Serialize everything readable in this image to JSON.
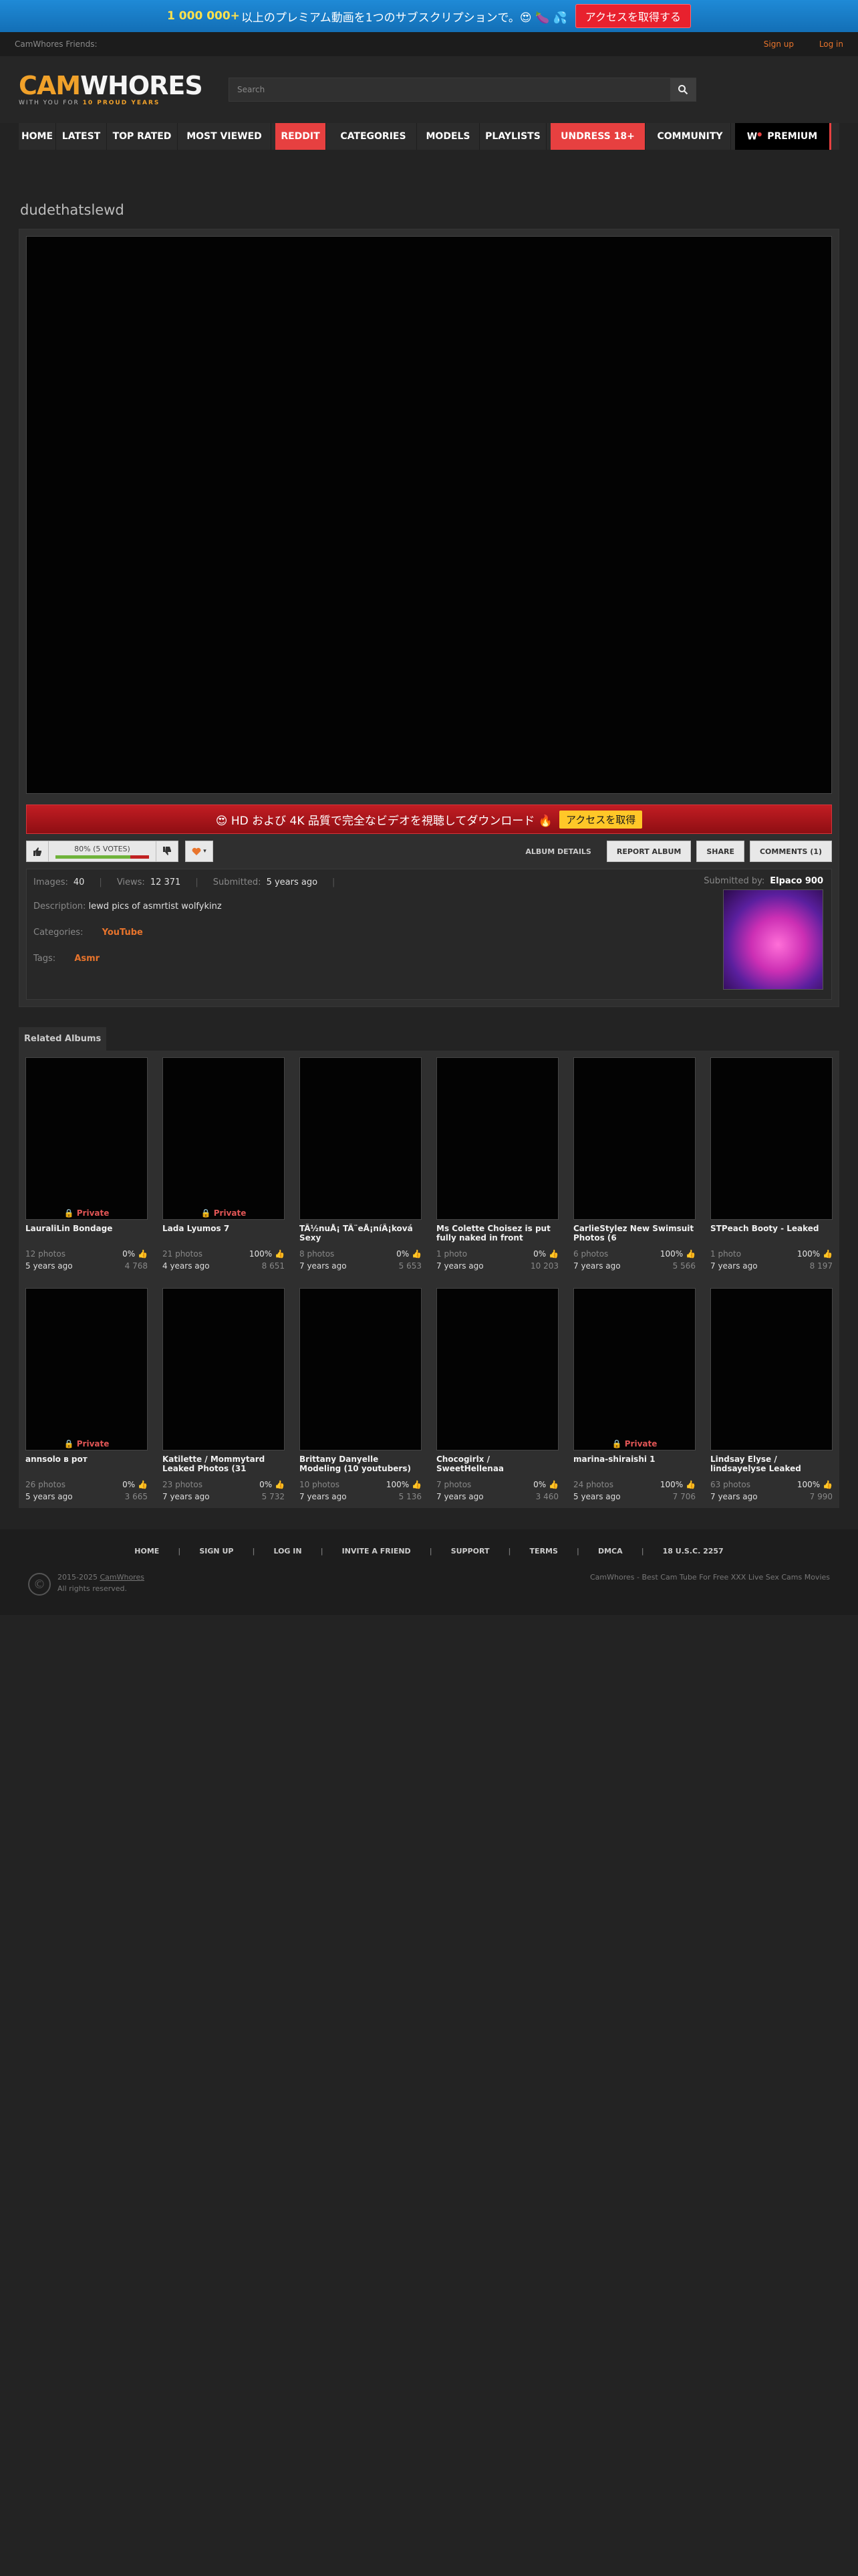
{
  "promo": {
    "count": "1 000 000+",
    "text": "以上のプレミアム動画を1つのサブスクリプションで。😍 🍆 💦",
    "button": "アクセスを取得する"
  },
  "topline": {
    "friends": "CamWhores Friends:",
    "signup": "Sign up",
    "login": "Log in"
  },
  "logo": {
    "cam": "CAM",
    "whores": "WHORES",
    "tagline_a": "WITH YOU FOR ",
    "tagline_b": "10 PROUD YEARS"
  },
  "search": {
    "placeholder": "Search"
  },
  "nav": [
    {
      "label": "HOME",
      "style": "normal"
    },
    {
      "label": "LATEST",
      "style": "normal"
    },
    {
      "label": "TOP RATED",
      "style": "normal"
    },
    {
      "label": "MOST VIEWED",
      "style": "normal"
    },
    {
      "label": "REDDIT",
      "style": "red"
    },
    {
      "label": "CATEGORIES",
      "style": "normal"
    },
    {
      "label": "MODELS",
      "style": "normal"
    },
    {
      "label": "PLAYLISTS",
      "style": "normal"
    },
    {
      "label": "UNDRESS 18+",
      "style": "red"
    },
    {
      "label": "COMMUNITY",
      "style": "normal"
    },
    {
      "label": "PREMIUM",
      "style": "black"
    }
  ],
  "album": {
    "title": "dudethatslewd",
    "banner_text": "😍 HD および 4K 品質で完全なビデオを視聴してダウンロード 🔥",
    "banner_button": "アクセスを取得",
    "rating_text": "80% (5 VOTES)",
    "rating": 0.8,
    "tabs": [
      "ALBUM DETAILS",
      "REPORT ALBUM",
      "SHARE",
      "COMMENTS (1)"
    ],
    "images_label": "Images:",
    "images": "40",
    "views_label": "Views:",
    "views": "12 371",
    "submitted_label": "Submitted:",
    "submitted": "5 years ago",
    "submitted_by_label": "Submitted by:",
    "submitted_by": "Elpaco 900",
    "description_label": "Description:",
    "description": "lewd pics of asmrtist wolfykinz",
    "categories_label": "Categories:",
    "category": "YouTube",
    "tags_label": "Tags:",
    "tag": "Asmr"
  },
  "related": {
    "tab": "Related Albums",
    "private_label": "Private",
    "items": [
      {
        "title": "LauraliLin Bondage",
        "photos": "12 photos",
        "pct": "0%",
        "age": "5 years ago",
        "views": "4 768",
        "private": true
      },
      {
        "title": "Lada Lyumos 7",
        "photos": "21 photos",
        "pct": "100%",
        "age": "4 years ago",
        "views": "8 651",
        "private": true
      },
      {
        "title": "TÃ½nuÅ¡ TÃ¨eÅ¡níÃ¡ková Sexy",
        "photos": "8 photos",
        "pct": "0%",
        "age": "7 years ago",
        "views": "5 653",
        "private": false
      },
      {
        "title": "Ms Colette Choisez is put fully naked in front",
        "photos": "1 photo",
        "pct": "0%",
        "age": "7 years ago",
        "views": "10 203",
        "private": false
      },
      {
        "title": "CarlieStylez New Swimsuit Photos (6",
        "photos": "6 photos",
        "pct": "100%",
        "age": "7 years ago",
        "views": "5 566",
        "private": false
      },
      {
        "title": "STPeach Booty - Leaked",
        "photos": "1 photo",
        "pct": "100%",
        "age": "7 years ago",
        "views": "8 197",
        "private": false
      },
      {
        "title": "annsolo в рот",
        "photos": "26 photos",
        "pct": "0%",
        "age": "5 years ago",
        "views": "3 665",
        "private": true
      },
      {
        "title": "Katilette / Mommytard Leaked Photos (31",
        "photos": "23 photos",
        "pct": "0%",
        "age": "7 years ago",
        "views": "5 732",
        "private": false
      },
      {
        "title": "Brittany Danyelle Modeling (10 youtubers)",
        "photos": "10 photos",
        "pct": "100%",
        "age": "7 years ago",
        "views": "5 136",
        "private": false
      },
      {
        "title": "Chocogirlx / SweetHellenaa",
        "photos": "7 photos",
        "pct": "0%",
        "age": "7 years ago",
        "views": "3 460",
        "private": false
      },
      {
        "title": "marina-shiraishi 1",
        "photos": "24 photos",
        "pct": "100%",
        "age": "5 years ago",
        "views": "7 706",
        "private": true
      },
      {
        "title": "Lindsay Elyse / lindsayelyse Leaked",
        "photos": "63 photos",
        "pct": "100%",
        "age": "7 years ago",
        "views": "7 990",
        "private": false
      }
    ]
  },
  "footer": {
    "links": [
      "HOME",
      "SIGN UP",
      "LOG IN",
      "INVITE A FRIEND",
      "SUPPORT",
      "TERMS",
      "DMCA",
      "18 U.S.C. 2257"
    ],
    "copyright": "2015-2025",
    "brand": "CamWhores",
    "rights": "All rights reserved.",
    "tagline": "CamWhores - Best Cam Tube For Free XXX Live Sex Cams Movies"
  },
  "colors": {
    "accent": "#e8742c",
    "promo": "#1f8ad6",
    "red": "#e74040"
  },
  "icons": {
    "search": "magnifier-icon",
    "thumbs_up": "thumbs-up-icon",
    "thumbs_down": "thumbs-down-icon",
    "fav": "heart-icon",
    "lock": "lock-icon",
    "copyright": "copyright-icon"
  }
}
